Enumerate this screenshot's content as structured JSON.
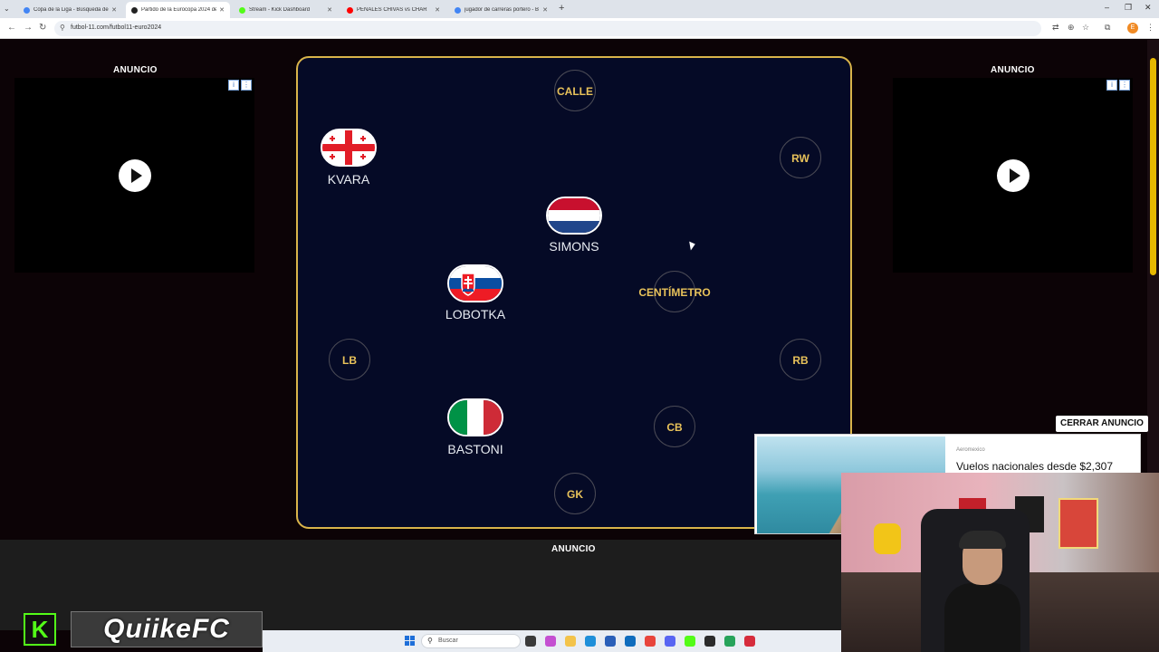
{
  "browser": {
    "tabs": [
      {
        "title": "Copa de la Liga - Búsqueda de",
        "favicon_color": "#4285f4",
        "active": false
      },
      {
        "title": "Partido de la Eurocopa 2024 de",
        "favicon_color": "#222222",
        "active": true
      },
      {
        "title": "Stream - Kick Dashboard",
        "favicon_color": "#53fc18",
        "active": false
      },
      {
        "title": "PENALES CHIVAS vs CHAR",
        "favicon_color": "#ff0000",
        "active": false
      },
      {
        "title": "jugador de carreras portero - B",
        "favicon_color": "#4285f4",
        "active": false
      }
    ],
    "url": "futbol-11.com/futbol11-euro2024",
    "profile_initial": "E"
  },
  "ads": {
    "left_label": "ANUNCIO",
    "right_label": "ANUNCIO",
    "bottom_label": "ANUNCIO",
    "close_label": "CERRAR ANUNCIO",
    "popup_brand": "Aeromexico",
    "popup_title": "Vuelos nacionales desde $2,307"
  },
  "lineup": {
    "empty_slots": [
      "CALLE",
      "RW",
      "CENTÍMETRO",
      "LB",
      "RB",
      "CB",
      "GK"
    ],
    "players": [
      {
        "name": "KVARA",
        "flag": "georgia"
      },
      {
        "name": "SIMONS",
        "flag": "netherlands"
      },
      {
        "name": "LOBOTKA",
        "flag": "slovakia"
      },
      {
        "name": "BASTONI",
        "flag": "italy"
      }
    ]
  },
  "overlay": {
    "kick_letter": "K",
    "streamer": "QuiikeFC"
  },
  "taskbar": {
    "search_placeholder": "Buscar"
  },
  "colors": {
    "accent_gold": "#d9b44a",
    "pitch_bg": "#050a26",
    "kick_green": "#53fc18"
  }
}
